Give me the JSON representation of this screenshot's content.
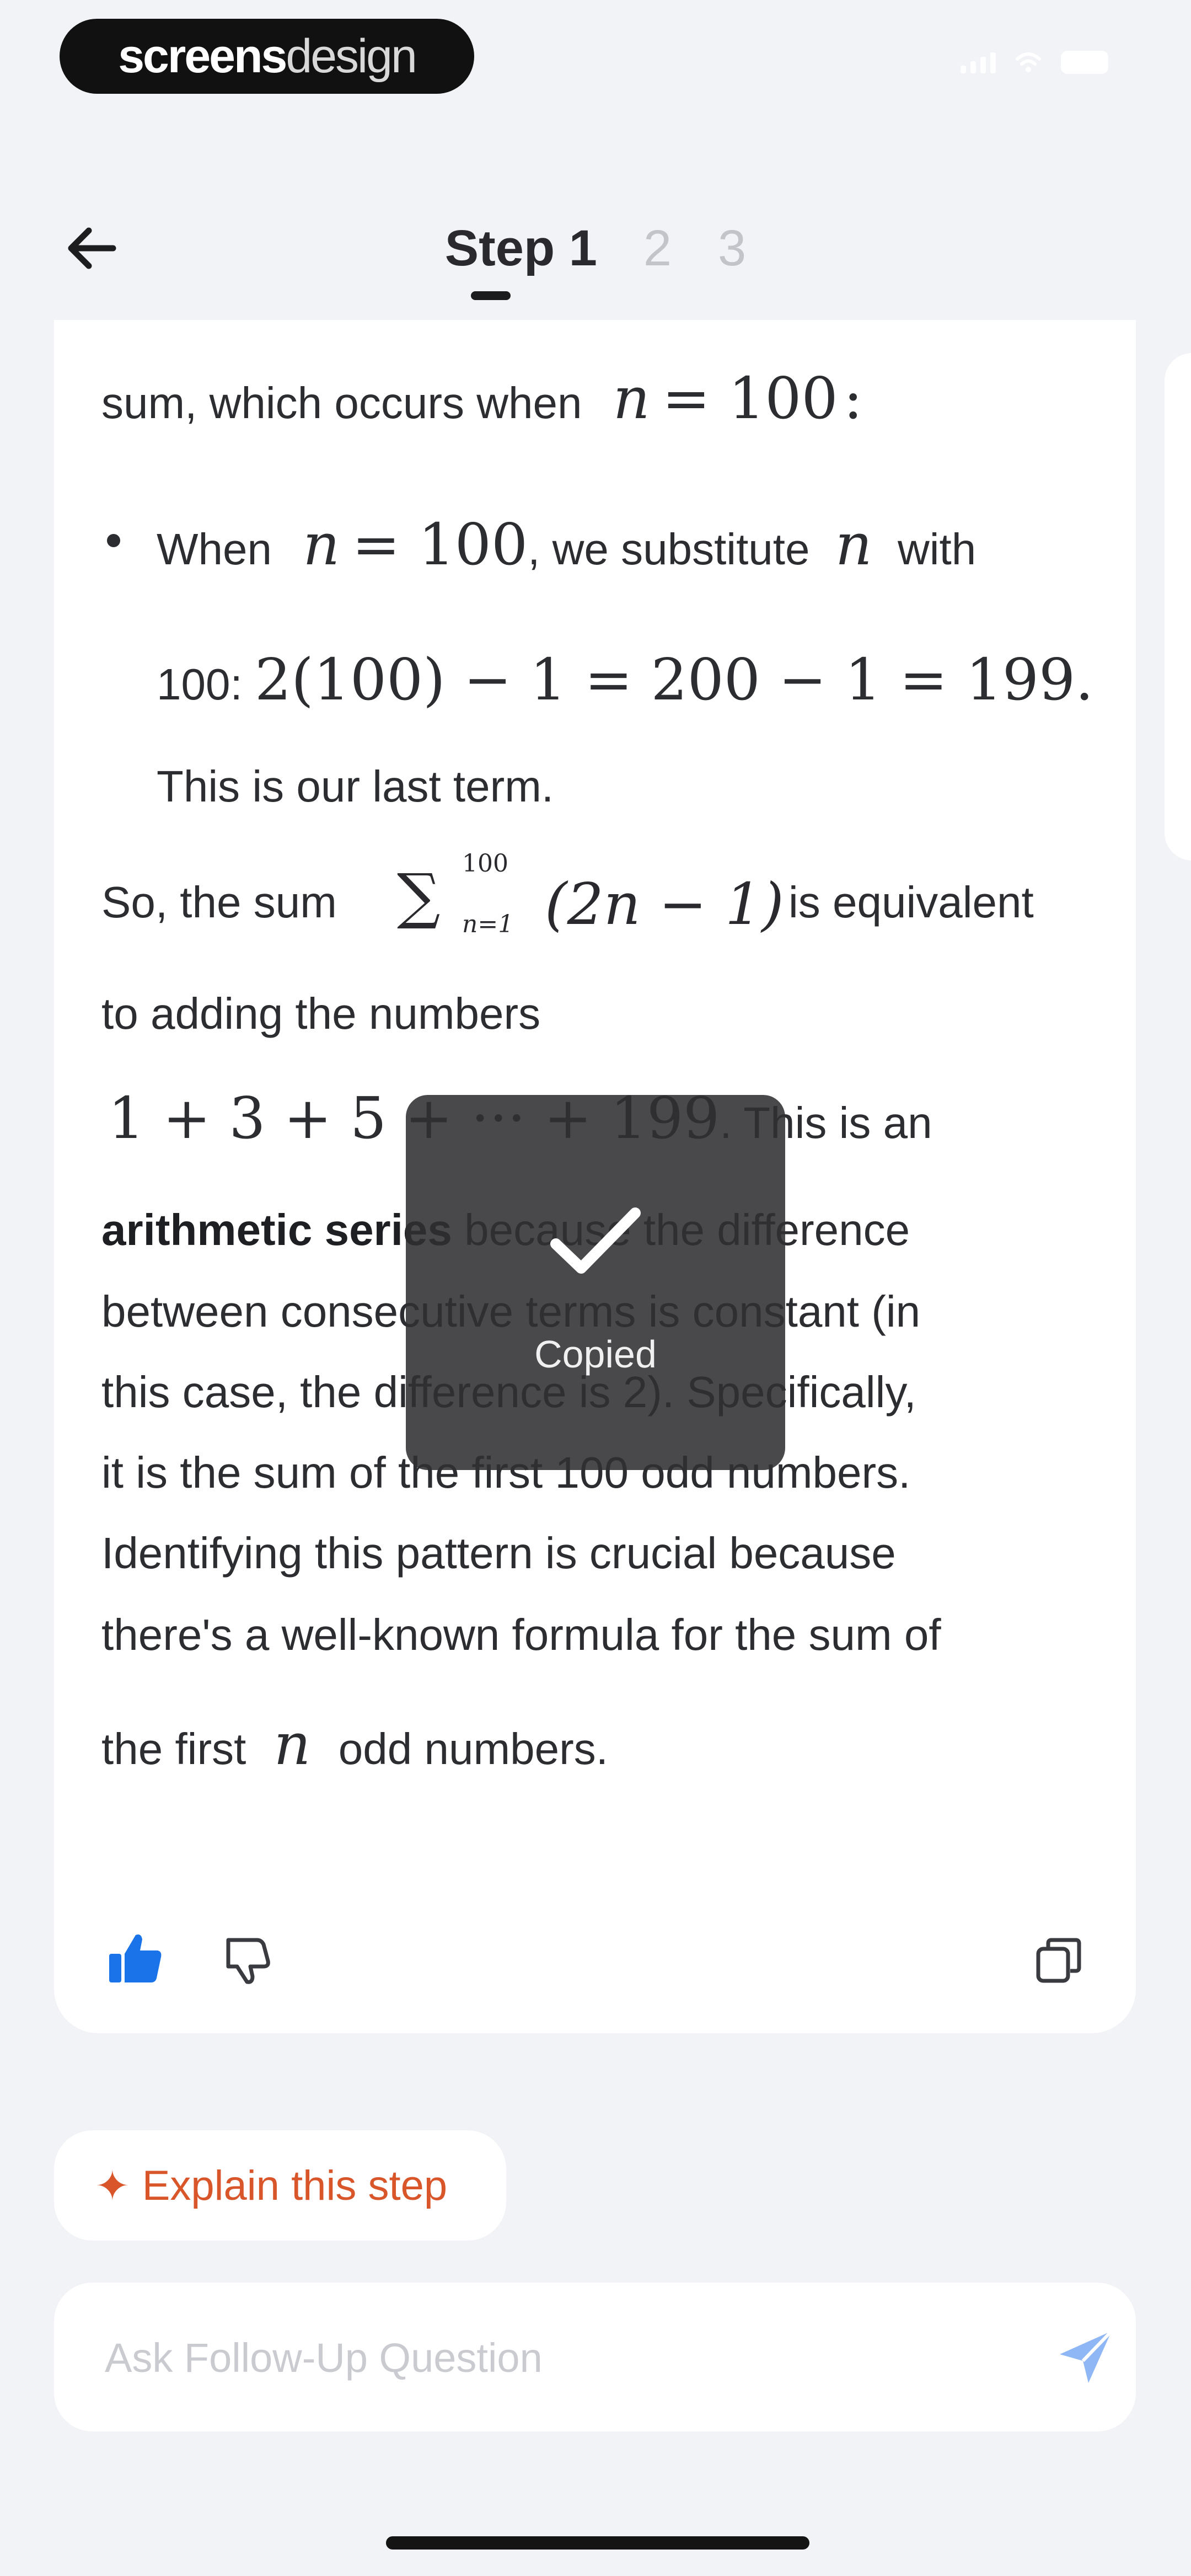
{
  "watermark": {
    "part1": "screens",
    "part2": "design"
  },
  "nav": {
    "steps": [
      {
        "label": "Step 1",
        "active": true
      },
      {
        "label": "2",
        "active": false
      },
      {
        "label": "3",
        "active": false
      }
    ]
  },
  "content": {
    "line1_text": "sum, which occurs when",
    "line1_math_var": "n",
    "line1_math_rest": "= 100",
    "line1_colon": ":",
    "bullet_when": "When",
    "bullet_math_var": "n",
    "bullet_math_rest": "= 100",
    "bullet_mid": ", we substitute",
    "bullet_math_var2": "n",
    "bullet_with": "with",
    "bullet_line2_text": "100:",
    "bullet_line2_math": "2(100) − 1 = 200 − 1 = 199",
    "bullet_line2_end": ".",
    "bullet_line3": "This is our last term.",
    "so_text": "So, the sum",
    "sum_sigma": "∑",
    "sum_sub": "n=1",
    "sum_sup": "100",
    "sum_expr": "(2n − 1)",
    "so_end": "is equivalent",
    "adding_line": "to adding the numbers",
    "series_math": "1 + 3 + 5 + ··· + 199",
    "series_after": ". This is an",
    "arith_bold": "arithmetic series",
    "arith_rest": "because the difference",
    "para_line2": "between consecutive terms is constant (in",
    "para_line3": "this case, the difference is 2). Specifically,",
    "para_line4": "it is the sum of the first 100 odd numbers.",
    "para_line5": "Identifying this pattern is crucial because",
    "para_line6": "there's a well-known formula for the sum of",
    "last_pre": "the first",
    "last_var": "n",
    "last_post": "odd numbers."
  },
  "actions": {
    "like_icon": "thumbs-up-icon",
    "dislike_icon": "thumbs-down-icon",
    "copy_icon": "copy-icon",
    "accent_color": "#1a73e8"
  },
  "toast": {
    "label": "Copied",
    "icon": "check-icon"
  },
  "explain": {
    "label": "Explain this step",
    "icon": "sparkle-icon",
    "color": "#d9562b"
  },
  "followup": {
    "placeholder": "Ask Follow-Up Question",
    "value": "",
    "send_icon": "send-icon"
  }
}
